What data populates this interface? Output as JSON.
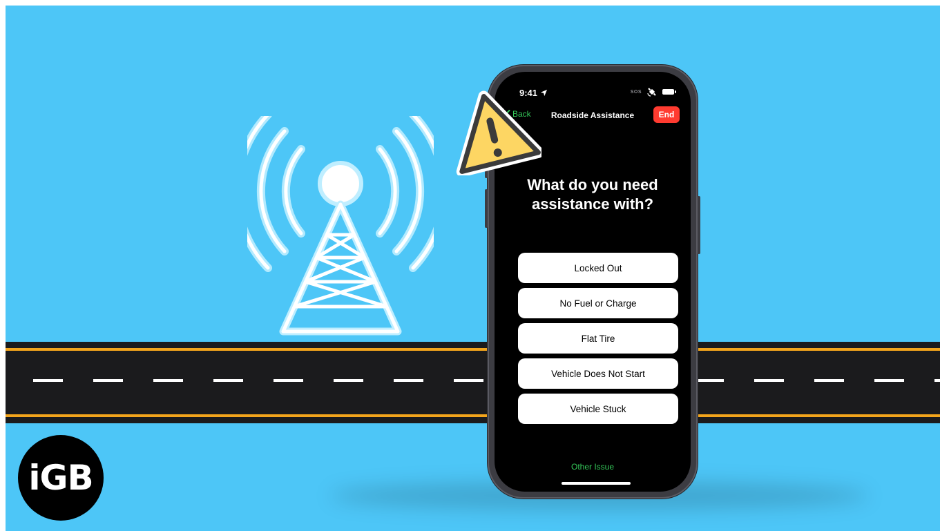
{
  "status_bar": {
    "time": "9:41",
    "sos": "SOS"
  },
  "nav": {
    "back_label": "Back",
    "title": "Roadside Assistance",
    "end_label": "End"
  },
  "question": {
    "line1": "What do you need",
    "line2": "assistance with?"
  },
  "options": [
    {
      "label": "Locked Out"
    },
    {
      "label": "No Fuel or Charge"
    },
    {
      "label": "Flat Tire"
    },
    {
      "label": "Vehicle Does Not Start"
    },
    {
      "label": "Vehicle Stuck"
    }
  ],
  "other_issue_label": "Other Issue",
  "logo_text": "iGB",
  "colors": {
    "background": "#4dc6f7",
    "accent_green": "#34c759",
    "end_red": "#ff3b30",
    "road": "#1b1b1d",
    "road_line": "#f3a51c",
    "warning": "#fdd663"
  },
  "icons": [
    "cell-tower-icon",
    "warning-icon",
    "location-arrow-icon",
    "satellite-icon",
    "battery-icon",
    "chevron-left-icon"
  ]
}
